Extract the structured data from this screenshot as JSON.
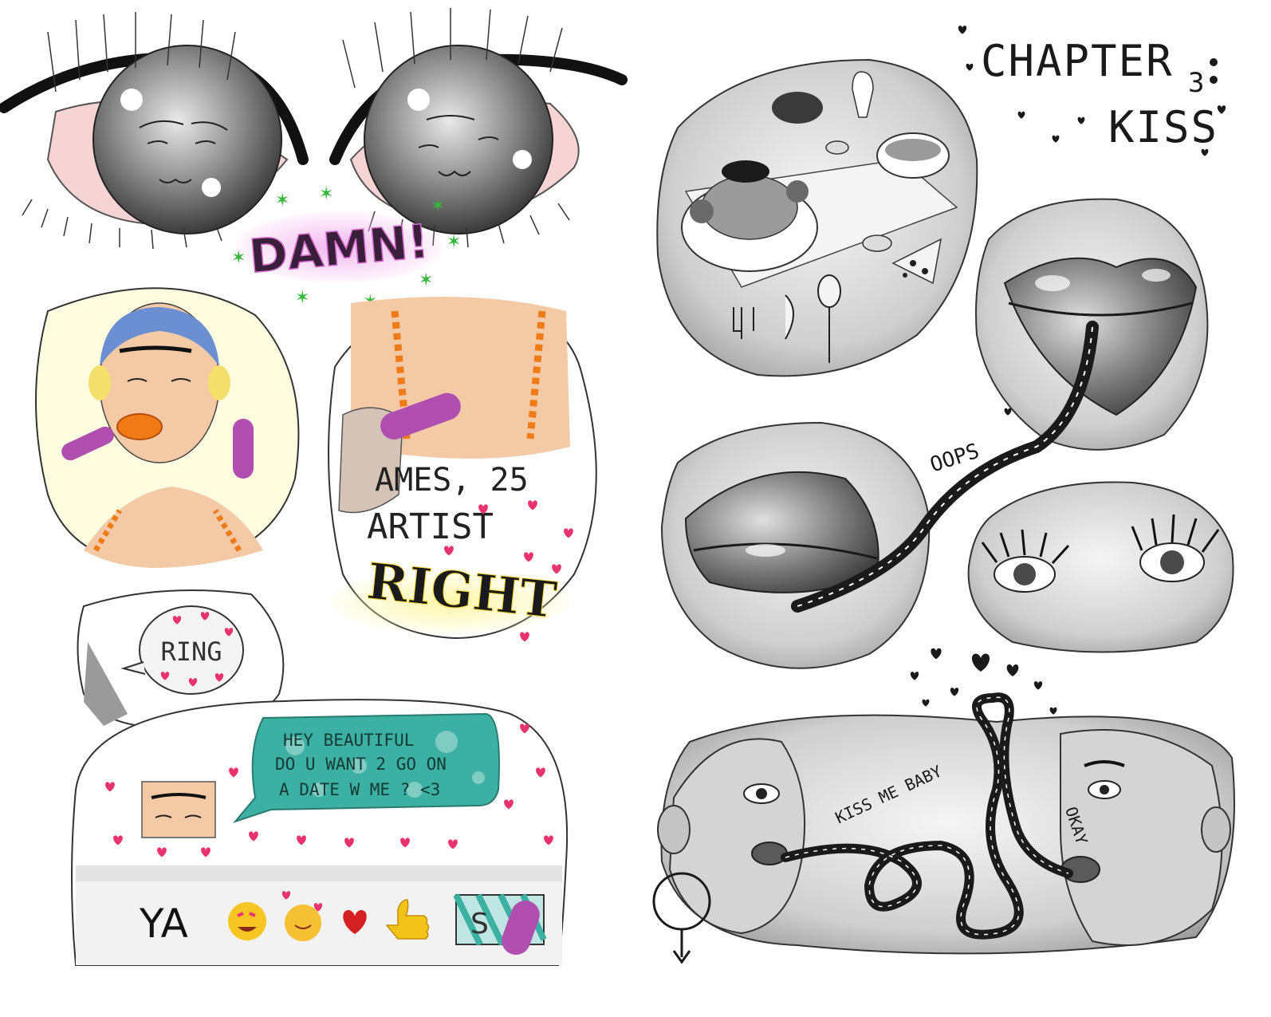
{
  "left_page": {
    "exclaim": "DAMN!",
    "profile_name": "AMES, 25",
    "profile_job": "ARTIST",
    "right_word": "RIGHT",
    "ring": "RING",
    "chat": {
      "line1": "HEY BEAUTIFUL",
      "line2": "DO U WANT 2 GO ON",
      "line3": "A DATE W ME ? <3"
    },
    "reply_text": "YA",
    "send_text": "S"
  },
  "right_page": {
    "chapter_label": "CHAPTER",
    "chapter_number": "3",
    "chapter_title": "KISS",
    "oops": "OOPS",
    "kiss_me_baby": "KISS ME BABY",
    "okay": "OKAY"
  },
  "colors": {
    "ink": "#1a1a1a",
    "nail_purple": "#b04fb0",
    "heart_pink": "#e8336d",
    "damn_glow": "#d86bd3",
    "star_green": "#35b53a",
    "chat_teal": "#3cb0a2",
    "skin": "#f3c9a6",
    "right_yellow": "#f4d235",
    "hair_blue": "#6b8fd1",
    "lips_orange": "#f07a16"
  }
}
